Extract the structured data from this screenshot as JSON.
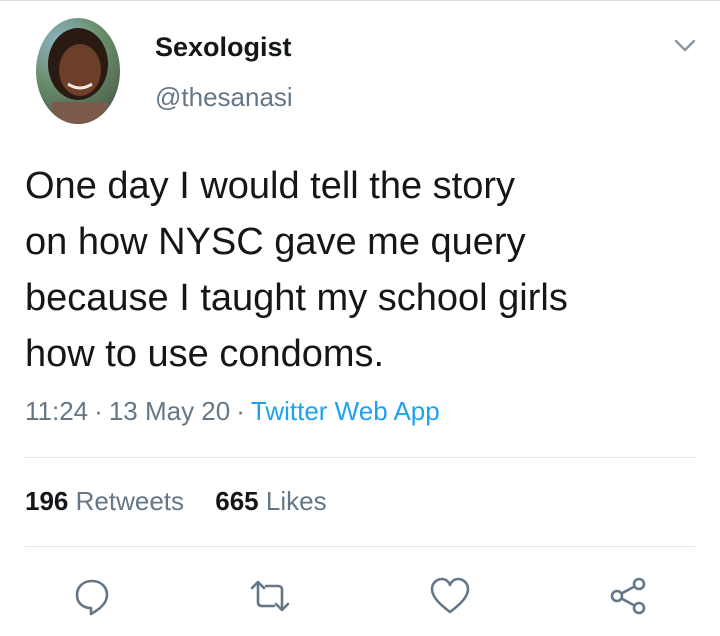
{
  "tweet": {
    "author_name": "Sexologist",
    "author_handle": "@thesanasi",
    "text": "One day I would tell the story\non how NYSC gave me query\nbecause I taught my school girls\nhow to use condoms.",
    "time": "11:24",
    "date": "13 May 20",
    "source": "Twitter Web App",
    "separator": "·"
  },
  "stats": {
    "retweets_count": "196",
    "retweets_label": "Retweets",
    "likes_count": "665",
    "likes_label": "Likes"
  },
  "icons": {
    "more": "chevron-down-icon",
    "reply": "reply-icon",
    "retweet": "retweet-icon",
    "like": "heart-icon",
    "share": "share-icon"
  },
  "colors": {
    "text": "#14171a",
    "secondary": "#657786",
    "link": "#1da1f2",
    "divider": "#e1e8ed"
  }
}
